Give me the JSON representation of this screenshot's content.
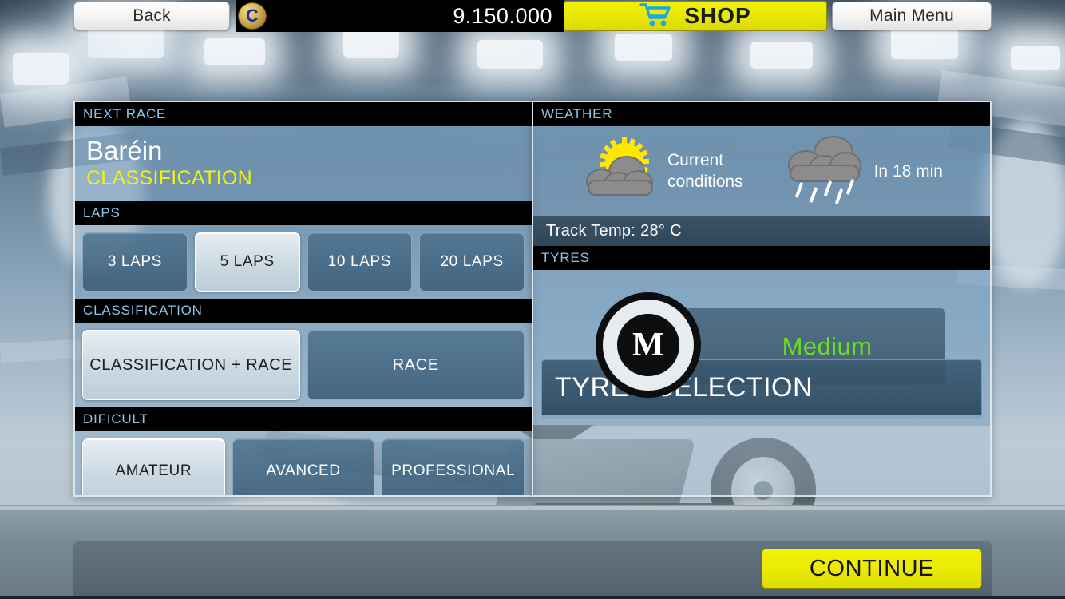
{
  "topbar": {
    "back_label": "Back",
    "coin_icon": "coin-icon",
    "coin_glyph": "C",
    "money": "9.150.000",
    "shop_label": "SHOP",
    "cart_icon": "shopping-cart-icon",
    "main_menu_label": "Main Menu"
  },
  "left_panel": {
    "header": "NEXT RACE",
    "race_name": "Baréin",
    "race_mode": "CLASSIFICATION",
    "laps": {
      "header": "LAPS",
      "options": [
        {
          "label": "3 LAPS",
          "selected": false
        },
        {
          "label": "5 LAPS",
          "selected": true
        },
        {
          "label": "10 LAPS",
          "selected": false
        },
        {
          "label": "20 LAPS",
          "selected": false
        }
      ]
    },
    "classification": {
      "header": "CLASSIFICATION",
      "options": [
        {
          "label": "CLASSIFICATION + RACE",
          "selected": true
        },
        {
          "label": "RACE",
          "selected": false
        }
      ]
    },
    "dificult": {
      "header": "DIFICULT",
      "options": [
        {
          "label": "AMATEUR",
          "selected": true
        },
        {
          "label": "AVANCED",
          "selected": false
        },
        {
          "label": "PROFESSIONAL",
          "selected": false
        }
      ]
    }
  },
  "right_panel": {
    "header": "WEATHER",
    "current": {
      "icon": "sun-behind-cloud-icon",
      "line1": "Current",
      "line2": "conditions"
    },
    "forecast": {
      "icon": "rain-cloud-icon",
      "label": "In 18 min"
    },
    "track_temp": "Track Temp: 28° C",
    "tyres": {
      "header": "TYRES",
      "compound_initial": "M",
      "compound_name": "Medium",
      "compound_color": "#66e020",
      "selection_button": "TYRES SELECTION"
    }
  },
  "bottom": {
    "continue_label": "CONTINUE"
  },
  "colors": {
    "accent_yellow": "#f2f205",
    "header_blue": "#8fc4e8",
    "mode_yellow": "#f2f20a",
    "tyre_green": "#66e020"
  }
}
